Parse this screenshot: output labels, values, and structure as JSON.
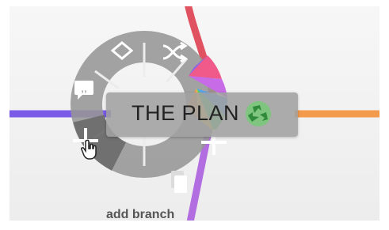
{
  "node": {
    "title": "THE PLAN",
    "icon": "recycle-icon"
  },
  "radial_menu": {
    "items": [
      {
        "name": "diamond-icon"
      },
      {
        "name": "shuffle-icon"
      },
      {
        "name": "color-wheel-icon"
      },
      {
        "name": "quote-comment-icon"
      },
      {
        "name": "add-branch-icon"
      },
      {
        "name": "add-child-icon"
      },
      {
        "name": "duplicate-icon"
      }
    ],
    "hovered_hint": "add branch"
  },
  "colors": {
    "branch_purple": "#7b5ce8",
    "branch_orange": "#f39a4d",
    "branch_red": "#e0525f",
    "branch_violet": "#b26ee0",
    "ring": "#9b9b9b",
    "ring_active": "#7a7a7a",
    "node_fill": "#a7a7a7"
  }
}
